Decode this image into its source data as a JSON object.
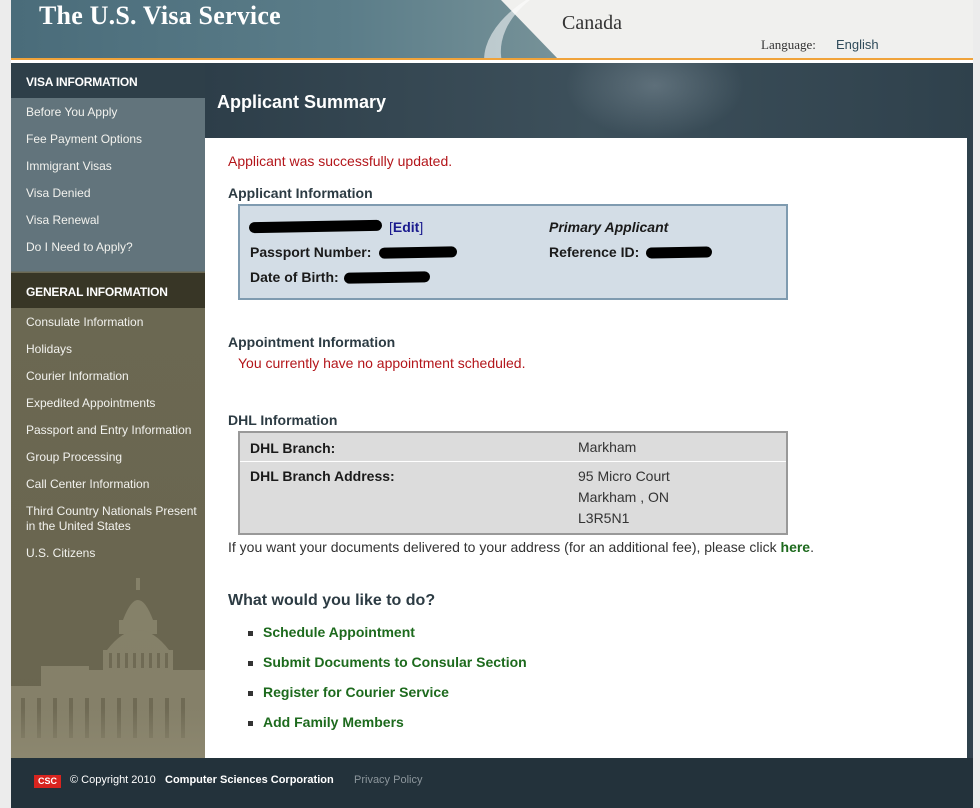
{
  "header": {
    "site_title": "The U.S. Visa Service",
    "country": "Canada",
    "language_label": "Language:",
    "language_value": "English"
  },
  "sidebar": {
    "visa_heading": "VISA INFORMATION",
    "visa_items": [
      "Before You Apply",
      "Fee Payment Options",
      "Immigrant Visas",
      "Visa Denied",
      "Visa Renewal",
      "Do I Need to Apply?"
    ],
    "general_heading": "GENERAL INFORMATION",
    "general_items": [
      "Consulate Information",
      "Holidays",
      "Courier Information",
      "Expedited Appointments",
      "Passport and Entry Information",
      "Group Processing",
      "Call Center Information",
      "Third Country Nationals Present in the United States",
      "U.S. Citizens"
    ]
  },
  "main": {
    "title": "Applicant Summary",
    "success_message": "Applicant was successfully updated.",
    "applicant_section_title": "Applicant Information",
    "edit_open": "[",
    "edit_label": "Edit",
    "edit_close": "]",
    "primary_label": "Primary Applicant",
    "passport_label": "Passport Number:",
    "reference_label": "Reference ID:",
    "dob_label": "Date of Birth:",
    "appointment_section_title": "Appointment Information",
    "no_appointment": "You currently have no appointment scheduled.",
    "dhl_section_title": "DHL Information",
    "dhl_branch_label": "DHL Branch:",
    "dhl_branch_value": "Markham",
    "dhl_address_label": "DHL Branch Address:",
    "dhl_address_lines": [
      "95 Micro Court",
      "Markham , ON",
      "L3R5N1"
    ],
    "deliver_text": "If you want your documents delivered to your address (for an additional fee), please click ",
    "deliver_link": "here",
    "deliver_end": ".",
    "todo_title": "What would you like to do?",
    "actions": [
      "Schedule Appointment",
      "Submit Documents to Consular Section",
      "Register for Courier Service",
      "Add Family Members"
    ]
  },
  "footer": {
    "logo_text": "CSC",
    "copyright": "© Copyright 2010",
    "company": "Computer Sciences Corporation",
    "privacy": "Privacy Policy"
  },
  "colors": {
    "accent_orange": "#f0a33a",
    "error_red": "#b3151a",
    "link_green": "#1d6a1d",
    "header_dark": "#2d3e49"
  }
}
